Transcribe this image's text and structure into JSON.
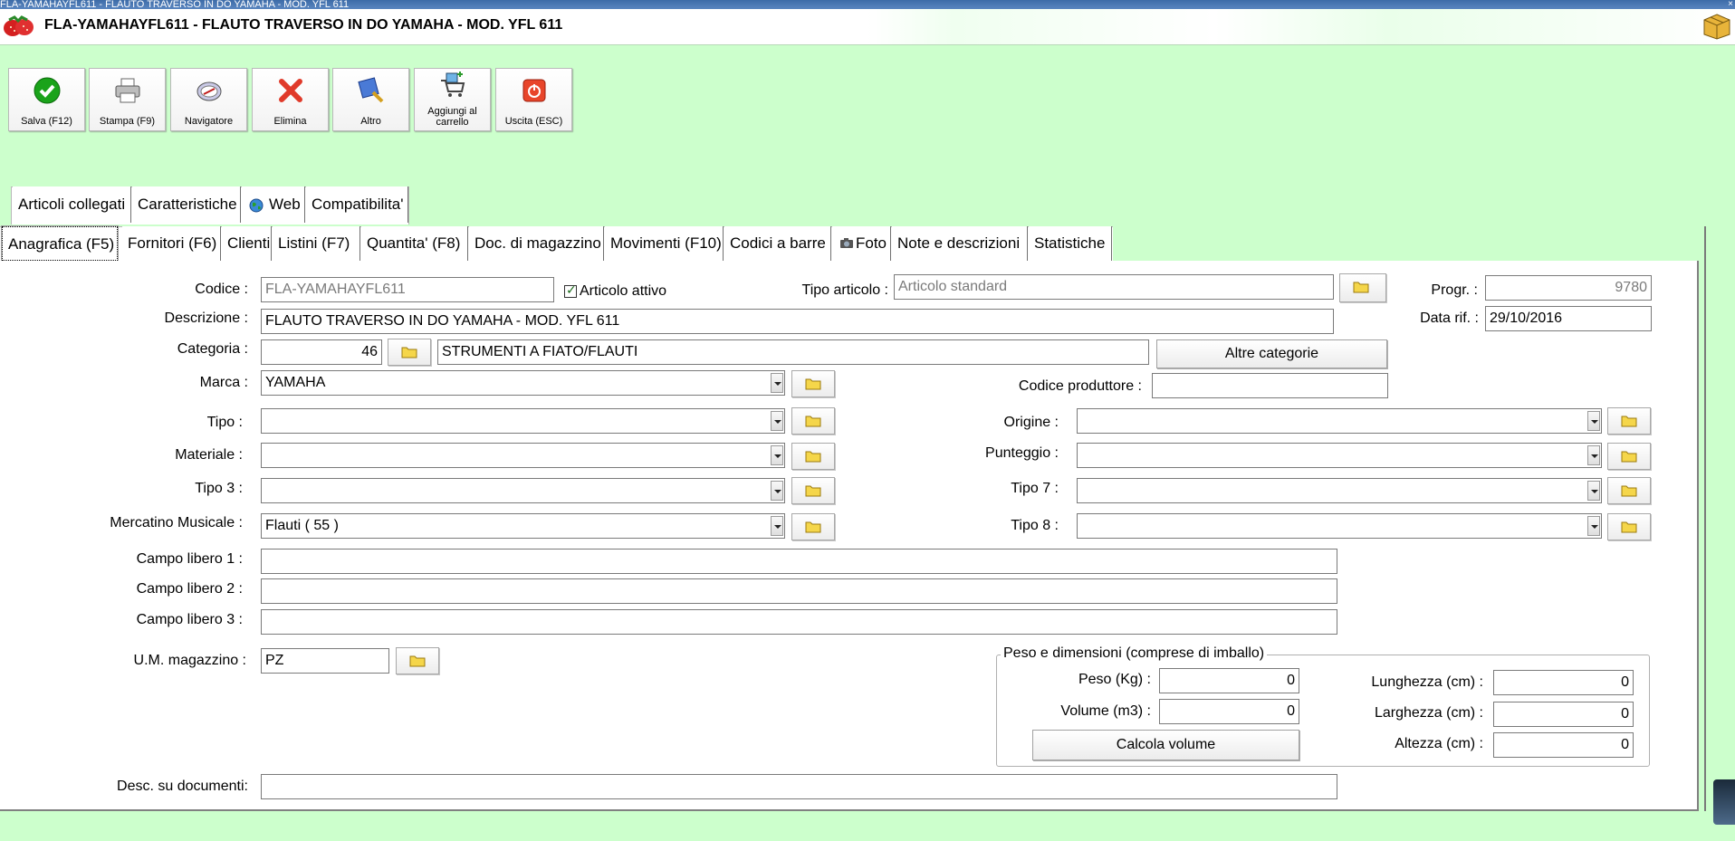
{
  "window": {
    "caption": "FLA-YAMAHAYFL611 - FLAUTO TRAVERSO IN DO YAMAHA - MOD. YFL 611",
    "close_glyph": "×",
    "header_title": "FLA-YAMAHAYFL611 - FLAUTO TRAVERSO IN DO YAMAHA - MOD. YFL 611"
  },
  "toolbar": {
    "save": "Salva (F12)",
    "print": "Stampa (F9)",
    "navigator": "Navigatore",
    "delete": "Elimina",
    "other": "Altro",
    "add_cart": "Aggiungi al carrello",
    "exit": "Uscita (ESC)"
  },
  "tabs_top": [
    "Articoli collegati",
    "Caratteristiche",
    "Web",
    "Compatibilita'"
  ],
  "tabs_bottom": [
    "Anagrafica (F5)",
    "Fornitori (F6)",
    "Clienti",
    "Listini (F7)",
    "Quantita' (F8)",
    "Doc. di magazzino",
    "Movimenti (F10)",
    "Codici a barre",
    "Foto",
    "Note e descrizioni",
    "Statistiche"
  ],
  "form": {
    "codice_label": "Codice :",
    "codice_value": "FLA-YAMAHAYFL611",
    "attivo_label": "Articolo attivo",
    "tipo_articolo_label": "Tipo articolo :",
    "tipo_articolo_value": "Articolo standard",
    "progr_label": "Progr. :",
    "progr_value": "9780",
    "descrizione_label": "Descrizione :",
    "descrizione_value": "FLAUTO TRAVERSO IN DO YAMAHA - MOD. YFL 611",
    "data_rif_label": "Data rif. :",
    "data_rif_value": "29/10/2016",
    "categoria_label": "Categoria :",
    "categoria_code": "46",
    "categoria_name": "STRUMENTI A FIATO/FLAUTI",
    "altre_categorie": "Altre categorie",
    "marca_label": "Marca :",
    "marca_value": "YAMAHA",
    "codice_produttore_label": "Codice produttore :",
    "codice_produttore_value": "",
    "tipo_label": "Tipo :",
    "tipo_value": "",
    "origine_label": "Origine :",
    "origine_value": "",
    "materiale_label": "Materiale :",
    "materiale_value": "",
    "punteggio_label": "Punteggio :",
    "punteggio_value": "",
    "tipo3_label": "Tipo 3 :",
    "tipo3_value": "",
    "tipo7_label": "Tipo 7 :",
    "tipo7_value": "",
    "mercatino_label": "Mercatino Musicale :",
    "mercatino_value": "Flauti ( 55 )",
    "tipo8_label": "Tipo 8 :",
    "tipo8_value": "",
    "campo1_label": "Campo libero 1 :",
    "campo1_value": "",
    "campo2_label": "Campo libero 2 :",
    "campo2_value": "",
    "campo3_label": "Campo libero 3 :",
    "campo3_value": "",
    "um_label": "U.M. magazzino :",
    "um_value": "PZ",
    "desc_doc_label": "Desc. su documenti:",
    "desc_doc_value": ""
  },
  "dimensions": {
    "group_title": "Peso e dimensioni (comprese di imballo)",
    "peso_label": "Peso (Kg) :",
    "peso_value": "0",
    "volume_label": "Volume (m3) :",
    "volume_value": "0",
    "calcola_volume": "Calcola volume",
    "lunghezza_label": "Lunghezza (cm) :",
    "lunghezza_value": "0",
    "larghezza_label": "Larghezza (cm) :",
    "larghezza_value": "0",
    "altezza_label": "Altezza (cm) :",
    "altezza_value": "0"
  },
  "colors": {
    "background": "#ccffcc",
    "titlebar": "#3d6ca8",
    "panel": "#ffffff"
  }
}
